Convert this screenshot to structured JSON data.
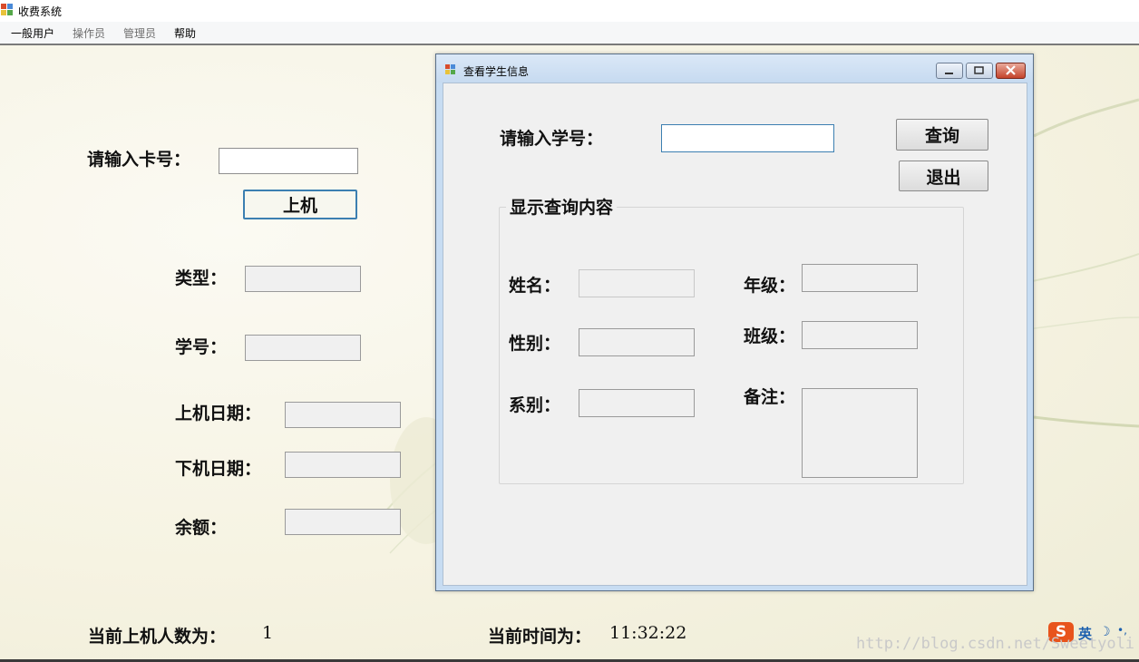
{
  "window": {
    "title": "收费系统"
  },
  "menu": [
    {
      "label": "一般用户",
      "enabled": true
    },
    {
      "label": "操作员",
      "enabled": false
    },
    {
      "label": "管理员",
      "enabled": false
    },
    {
      "label": "帮助",
      "enabled": true
    }
  ],
  "main": {
    "card_label": "请输入卡号：",
    "card_value": "",
    "login_button": "上机",
    "type_label": "类型：",
    "type_value": "",
    "student_no_label": "学号：",
    "student_no_value": "",
    "login_date_label": "上机日期：",
    "login_date_value": "",
    "logout_date_label": "下机日期：",
    "logout_date_value": "",
    "balance_label": "余额：",
    "balance_value": ""
  },
  "status": {
    "online_label": "当前上机人数为：",
    "online_count": "1",
    "time_label": "当前时间为：",
    "time_value": "11:32:22"
  },
  "dialog": {
    "title": "查看学生信息",
    "student_no_label": "请输入学号：",
    "student_no_value": "",
    "query_button": "查询",
    "exit_button": "退出",
    "group_title": "显示查询内容",
    "name_label": "姓名：",
    "name_value": "",
    "gender_label": "性别：",
    "gender_value": "",
    "department_label": "系别：",
    "department_value": "",
    "grade_label": "年级：",
    "grade_value": "",
    "class_label": "班级：",
    "class_value": "",
    "remark_label": "备注：",
    "remark_value": ""
  },
  "ime": {
    "logo": "S",
    "mode": "英",
    "moon": "☽",
    "dots": "•,"
  },
  "watermark": "http://blog.csdn.net/Sweetyoli",
  "colors": {
    "accent": "#3c7fb1",
    "dialog_frame": "#c7dcf2",
    "ime": "#e8541c"
  }
}
